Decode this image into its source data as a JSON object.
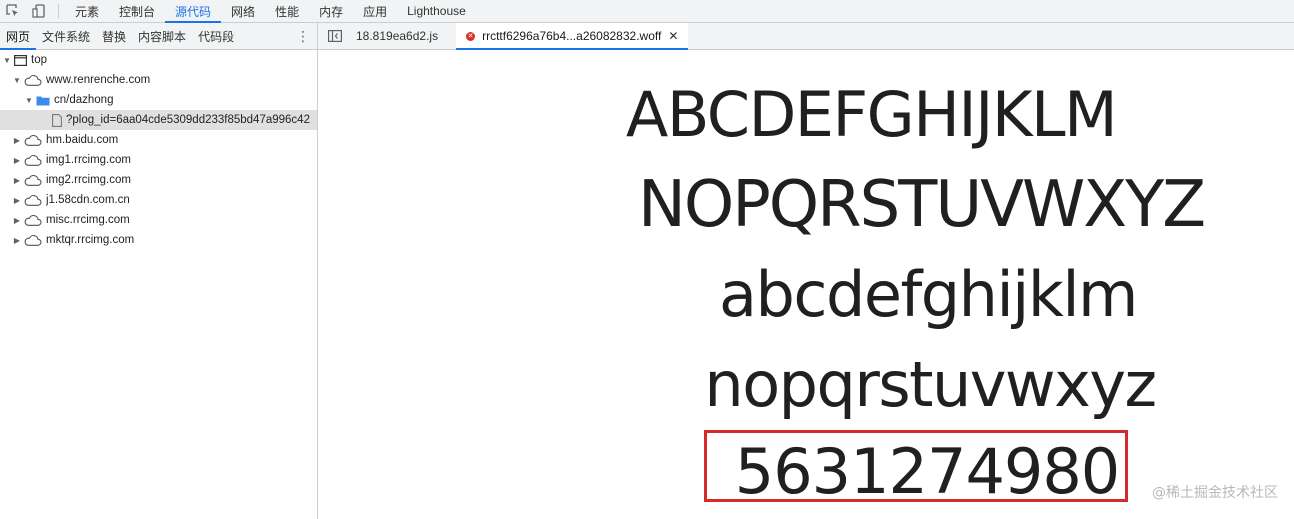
{
  "toolbar": {
    "tabs": [
      "元素",
      "控制台",
      "源代码",
      "网络",
      "性能",
      "内存",
      "应用",
      "Lighthouse"
    ],
    "active_tab_index": 2
  },
  "navigator": {
    "tabs": [
      "网页",
      "文件系统",
      "替换",
      "内容脚本",
      "代码段"
    ],
    "more_icon": "⋮",
    "tree": [
      {
        "label": "top"
      },
      {
        "label": "www.renrenche.com"
      },
      {
        "label": "cn/dazhong"
      },
      {
        "label": "?plog_id=6aa04cde5309dd233f85bd47a996c42"
      },
      {
        "label": "hm.baidu.com"
      },
      {
        "label": "img1.rrcimg.com"
      },
      {
        "label": "img2.rrcimg.com"
      },
      {
        "label": "j1.58cdn.com.cn"
      },
      {
        "label": "misc.rrcimg.com"
      },
      {
        "label": "mktqr.rrcimg.com"
      }
    ]
  },
  "editor": {
    "tabs": [
      {
        "label": "18.819ea6d2.js"
      },
      {
        "label": "rrcttf6296a76b4...a26082832.woff"
      }
    ],
    "close_glyph": "✕"
  },
  "preview": {
    "lines": [
      "ABCDEFGHIJKLM",
      "NOPQRSTUVWXYZ",
      "abcdefghijklm",
      "nopqrstuvwxyz",
      "5631274980"
    ],
    "highlight_color": "#d42a2a"
  },
  "watermark": "@稀土掘金技术社区",
  "colors": {
    "accent": "#1a73e8",
    "error": "#d93025",
    "selected_row": "#e0e0e0"
  }
}
